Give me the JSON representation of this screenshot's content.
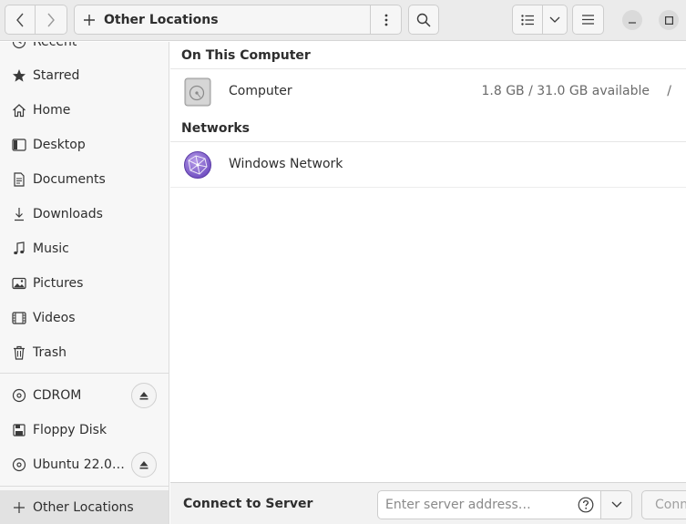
{
  "header": {
    "path_label": "Other Locations"
  },
  "sidebar": {
    "items": [
      {
        "label": "Recent",
        "icon": "clock-icon"
      },
      {
        "label": "Starred",
        "icon": "star-icon"
      },
      {
        "label": "Home",
        "icon": "home-icon"
      },
      {
        "label": "Desktop",
        "icon": "desktop-icon"
      },
      {
        "label": "Documents",
        "icon": "document-icon"
      },
      {
        "label": "Downloads",
        "icon": "download-icon"
      },
      {
        "label": "Music",
        "icon": "music-icon"
      },
      {
        "label": "Pictures",
        "icon": "picture-icon"
      },
      {
        "label": "Videos",
        "icon": "video-icon"
      },
      {
        "label": "Trash",
        "icon": "trash-icon"
      }
    ],
    "devices": [
      {
        "label": "CDROM",
        "icon": "disc-icon",
        "ejectable": true
      },
      {
        "label": "Floppy Disk",
        "icon": "floppy-icon",
        "ejectable": false
      },
      {
        "label": "Ubuntu 22.0…",
        "icon": "disc-icon",
        "ejectable": true
      }
    ],
    "other_locations": "Other Locations"
  },
  "main": {
    "on_this_computer_title": "On This Computer",
    "computer": {
      "name": "Computer",
      "info": "1.8 GB / 31.0 GB available",
      "path": "/"
    },
    "networks_title": "Networks",
    "network": {
      "name": "Windows Network"
    }
  },
  "bottom": {
    "connect_label": "Connect to Server",
    "server_placeholder": "Enter server address…",
    "connect_button": "Connect"
  }
}
